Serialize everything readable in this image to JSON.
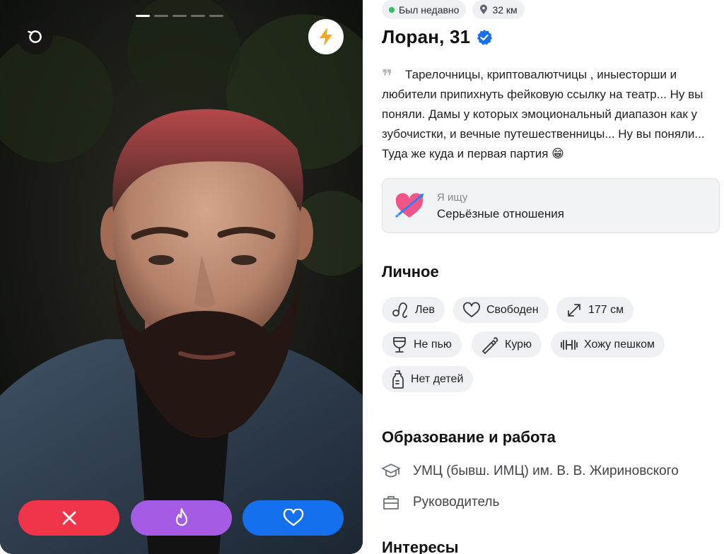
{
  "photo": {
    "progress_total": 5,
    "progress_active_index": 0
  },
  "buttons": {
    "undo_icon": "undo-icon",
    "boost_icon": "lightning-icon",
    "dislike_icon": "close-icon",
    "superlike_icon": "flame-icon",
    "like_icon": "heart-icon"
  },
  "colors": {
    "dislike": "#f0344a",
    "superlike": "#a65be6",
    "like": "#1570ef",
    "online": "#2dbf5a",
    "verified": "#1a6ef0",
    "boost": "#f5a623"
  },
  "status": {
    "online_text": "Был недавно",
    "distance": "32 км"
  },
  "profile": {
    "name_age": "Лоран, 31",
    "verified": true,
    "bio": "Тарелочницы, криптовалютчицы , иныесторши и любители припихнуть фейковую ссылку на театр... Ну вы поняли. Дамы у которых эмоциональный диапазон как у зубочистки, и вечные путешественницы... Ну вы поняли... Туда же куда и первая партия 😁"
  },
  "looking_for": {
    "label": "Я ищу",
    "value": "Серьёзные отношения"
  },
  "personal": {
    "title": "Личное",
    "chips": [
      {
        "icon": "leo-zodiac-icon",
        "label": "Лев"
      },
      {
        "icon": "heart-outline-icon",
        "label": "Свободен"
      },
      {
        "icon": "height-arrows-icon",
        "label": "177 см"
      },
      {
        "icon": "wine-glass-icon",
        "label": "Не пью"
      },
      {
        "icon": "cigarette-icon",
        "label": "Курю"
      },
      {
        "icon": "dumbbell-icon",
        "label": "Хожу пешком"
      },
      {
        "icon": "baby-bottle-icon",
        "label": "Нет детей"
      }
    ]
  },
  "education": {
    "title": "Образование и работа",
    "items": [
      {
        "icon": "graduation-cap-icon",
        "text": "УМЦ (бывш. ИМЦ) им. В. В. Жириновского"
      },
      {
        "icon": "briefcase-icon",
        "text": "Руководитель"
      }
    ]
  },
  "interests": {
    "title": "Интересы"
  }
}
